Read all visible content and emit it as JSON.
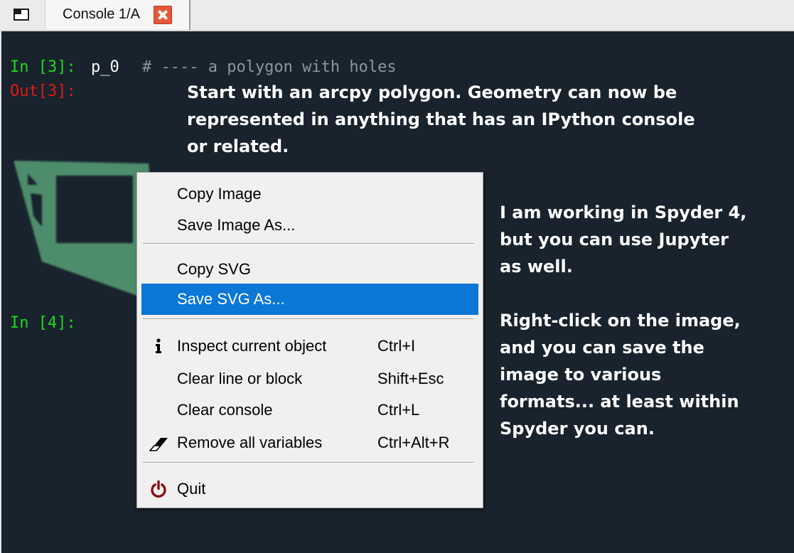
{
  "tabbar": {
    "options_icon": "window-options-icon",
    "console_tab": {
      "label": "Console 1/A",
      "close_icon": "close-icon",
      "close_color": "#e5583a"
    }
  },
  "console": {
    "background": "#19232d",
    "cells": [
      {
        "in_prompt": "In [3]:",
        "code": "p_0",
        "comment": "# ---- a polygon with holes",
        "out_prompt": "Out[3]:"
      },
      {
        "in_prompt": "In [4]:"
      }
    ],
    "output_image": {
      "name": "polygon-with-holes-image",
      "fill_color": "#4e8d6c"
    },
    "annotations": [
      {
        "lines": [
          "Start with an arcpy polygon.  Geometry can now be",
          "represented in anything that has an IPython console",
          "or related."
        ]
      },
      {
        "lines": [
          "I am working in Spyder 4,",
          "but you can use Jupyter",
          "as well."
        ]
      },
      {
        "lines": [
          "Right-click on the image,",
          "and you can save the",
          "image to various",
          "formats... at least within",
          "Spyder you can."
        ]
      }
    ]
  },
  "context_menu": {
    "items": [
      {
        "label": "Copy Image",
        "shortcut": "",
        "icon": ""
      },
      {
        "label": "Save Image As...",
        "shortcut": "",
        "icon": ""
      },
      {
        "label": "Copy SVG",
        "shortcut": "",
        "icon": ""
      },
      {
        "label": "Save SVG As...",
        "shortcut": "",
        "icon": "",
        "selected": true
      },
      {
        "label": "Inspect current object",
        "shortcut": "Ctrl+I",
        "icon": "info-icon"
      },
      {
        "label": "Clear line or block",
        "shortcut": "Shift+Esc",
        "icon": ""
      },
      {
        "label": "Clear console",
        "shortcut": "Ctrl+L",
        "icon": ""
      },
      {
        "label": "Remove all variables",
        "shortcut": "Ctrl+Alt+R",
        "icon": "eraser-icon"
      },
      {
        "label": "Quit",
        "shortcut": "",
        "icon": "power-icon"
      }
    ],
    "selected_color": "#0b77d6",
    "quit_icon_color": "#8b1010"
  }
}
